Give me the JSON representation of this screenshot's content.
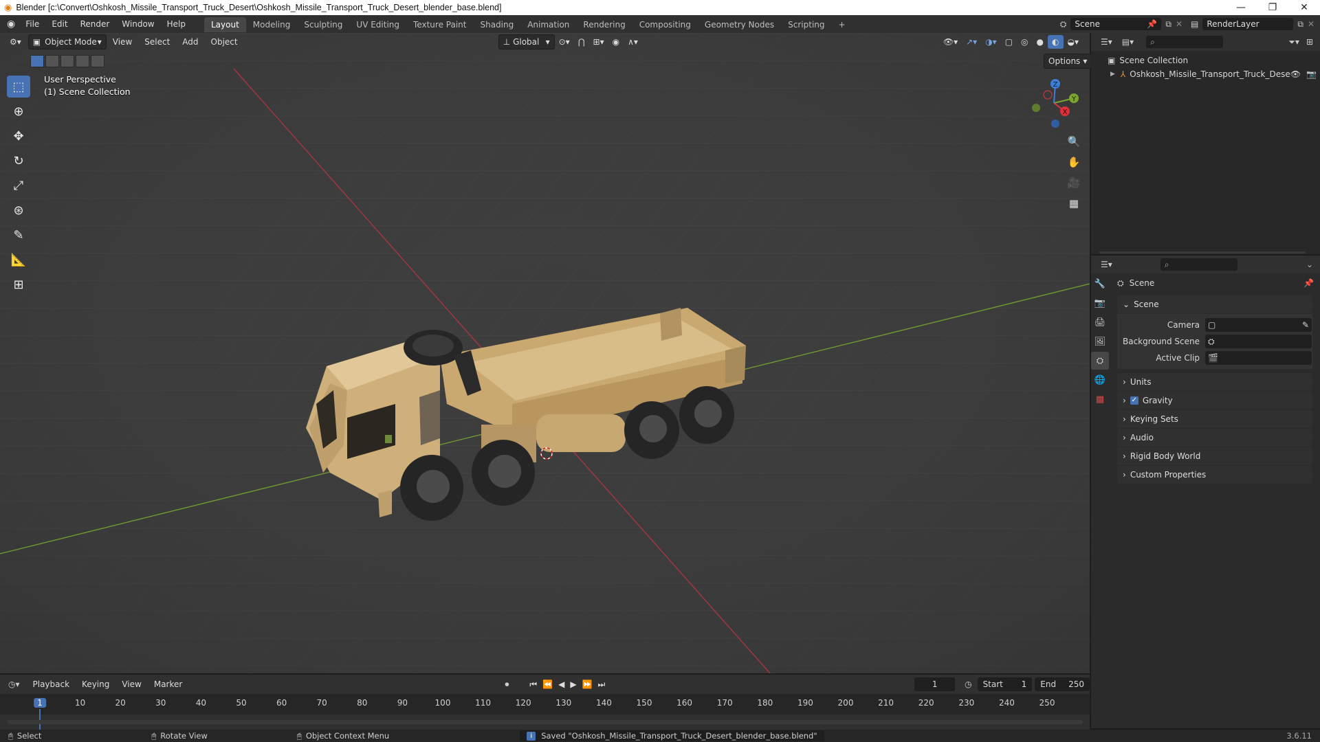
{
  "window": {
    "title": "Blender [c:\\Convert\\Oshkosh_Missile_Transport_Truck_Desert\\Oshkosh_Missile_Transport_Truck_Desert_blender_base.blend]"
  },
  "menu": {
    "items": [
      "File",
      "Edit",
      "Render",
      "Window",
      "Help"
    ]
  },
  "workspaces": {
    "tabs": [
      "Layout",
      "Modeling",
      "Sculpting",
      "UV Editing",
      "Texture Paint",
      "Shading",
      "Animation",
      "Rendering",
      "Compositing",
      "Geometry Nodes",
      "Scripting"
    ],
    "add": "+"
  },
  "topright": {
    "scene": "Scene",
    "view_layer": "RenderLayer"
  },
  "viewport": {
    "mode": "Object Mode",
    "menus": [
      "View",
      "Select",
      "Add",
      "Object"
    ],
    "orientation": "Global",
    "options": "Options",
    "perspective": "User Perspective",
    "collection": "(1) Scene Collection",
    "gizmo_axes": {
      "z": "Z",
      "y": "Y",
      "x": "X"
    }
  },
  "outliner": {
    "root": "Scene Collection",
    "object": "Oshkosh_Missile_Transport_Truck_Dese"
  },
  "properties": {
    "context": "Scene",
    "panel": "Scene",
    "fields": {
      "camera": "Camera",
      "background_scene": "Background Scene",
      "active_clip": "Active Clip"
    },
    "sections": [
      "Units",
      "Gravity",
      "Keying Sets",
      "Audio",
      "Rigid Body World",
      "Custom Properties"
    ]
  },
  "timeline": {
    "menus": [
      "Playback",
      "Keying",
      "View",
      "Marker"
    ],
    "current_frame": "1",
    "start_label": "Start",
    "start": "1",
    "end_label": "End",
    "end": "250",
    "ruler": [
      "1",
      "10",
      "20",
      "30",
      "40",
      "50",
      "60",
      "70",
      "80",
      "90",
      "100",
      "110",
      "120",
      "130",
      "140",
      "150",
      "160",
      "170",
      "180",
      "190",
      "200",
      "210",
      "220",
      "230",
      "240",
      "250"
    ]
  },
  "statusbar": {
    "select": "Select",
    "rotate": "Rotate View",
    "context_menu": "Object Context Menu",
    "message": "Saved \"Oshkosh_Missile_Transport_Truck_Desert_blender_base.blend\"",
    "version": "3.6.11"
  },
  "colors": {
    "accent": "#4772b3",
    "x_axis": "#e0303a",
    "y_axis": "#7ba52f",
    "z_axis": "#3c7fd8",
    "truck": "#d2b27c"
  }
}
